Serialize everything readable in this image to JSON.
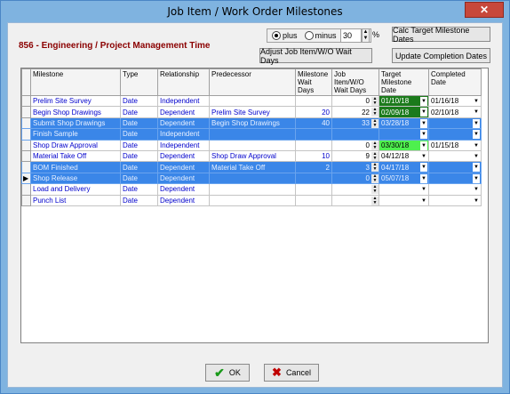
{
  "window": {
    "title": "Job Item / Work Order Milestones",
    "close_symbol": "✕"
  },
  "header": {
    "job_title": "856 - Engineering / Project Management Time"
  },
  "controls": {
    "plus_label": "plus",
    "minus_label": "minus",
    "percent_value": "30",
    "percent_sign": "%",
    "calc_button": "Calc Target Milestone Dates",
    "adjust_button": "Adjust Job Item/W/O Wait Days",
    "update_button": "Update Completion Dates"
  },
  "grid": {
    "columns": [
      "Milestone",
      "Type",
      "Relationship",
      "Predecessor",
      "Milestone Wait Days",
      "Job Item/W/O Wait Days",
      "Target Milestone Date",
      "Completed Date"
    ],
    "rows": [
      {
        "milestone": "Prelim Site Survey",
        "type": "Date",
        "relationship": "Independent",
        "predecessor": "",
        "milestone_wait": "",
        "job_wait": "0",
        "target": "01/10/18",
        "completed": "01/16/18"
      },
      {
        "milestone": "Begin Shop Drawings",
        "type": "Date",
        "relationship": "Dependent",
        "predecessor": "Prelim Site Survey",
        "milestone_wait": "20",
        "job_wait": "22",
        "target": "02/09/18",
        "completed": "02/10/18"
      },
      {
        "milestone": "Submit Shop Drawings",
        "type": "Date",
        "relationship": "Dependent",
        "predecessor": "Begin Shop Drawings",
        "milestone_wait": "40",
        "job_wait": "33",
        "target": "03/28/18",
        "completed": ""
      },
      {
        "milestone": "Finish Sample",
        "type": "Date",
        "relationship": "Independent",
        "predecessor": "",
        "milestone_wait": "",
        "job_wait": "",
        "target": "",
        "completed": ""
      },
      {
        "milestone": "Shop Draw Approval",
        "type": "Date",
        "relationship": "Independent",
        "predecessor": "",
        "milestone_wait": "",
        "job_wait": "0",
        "target": "03/30/18",
        "completed": "01/15/18"
      },
      {
        "milestone": "Material Take Off",
        "type": "Date",
        "relationship": "Dependent",
        "predecessor": "Shop Draw Approval",
        "milestone_wait": "10",
        "job_wait": "9",
        "target": "04/12/18",
        "completed": ""
      },
      {
        "milestone": "BOM Finished",
        "type": "Date",
        "relationship": "Dependent",
        "predecessor": "Material Take Off",
        "milestone_wait": "2",
        "job_wait": "3",
        "target": "04/17/18",
        "completed": ""
      },
      {
        "milestone": "Shop Release",
        "type": "Date",
        "relationship": "Dependent",
        "predecessor": "",
        "milestone_wait": "",
        "job_wait": "0",
        "target": "05/07/18",
        "completed": ""
      },
      {
        "milestone": "Load and Delivery",
        "type": "Date",
        "relationship": "Dependent",
        "predecessor": "",
        "milestone_wait": "",
        "job_wait": "",
        "target": "",
        "completed": ""
      },
      {
        "milestone": "Punch List",
        "type": "Date",
        "relationship": "Dependent",
        "predecessor": "",
        "milestone_wait": "",
        "job_wait": "",
        "target": "",
        "completed": ""
      }
    ]
  },
  "footer": {
    "ok_label": "OK",
    "cancel_label": "Cancel"
  },
  "colors": {
    "selected_row": "#3a86e8",
    "target_dark_green": "#1b7a1b",
    "target_light_green": "#4ef04e",
    "header_red": "#8b0000"
  }
}
